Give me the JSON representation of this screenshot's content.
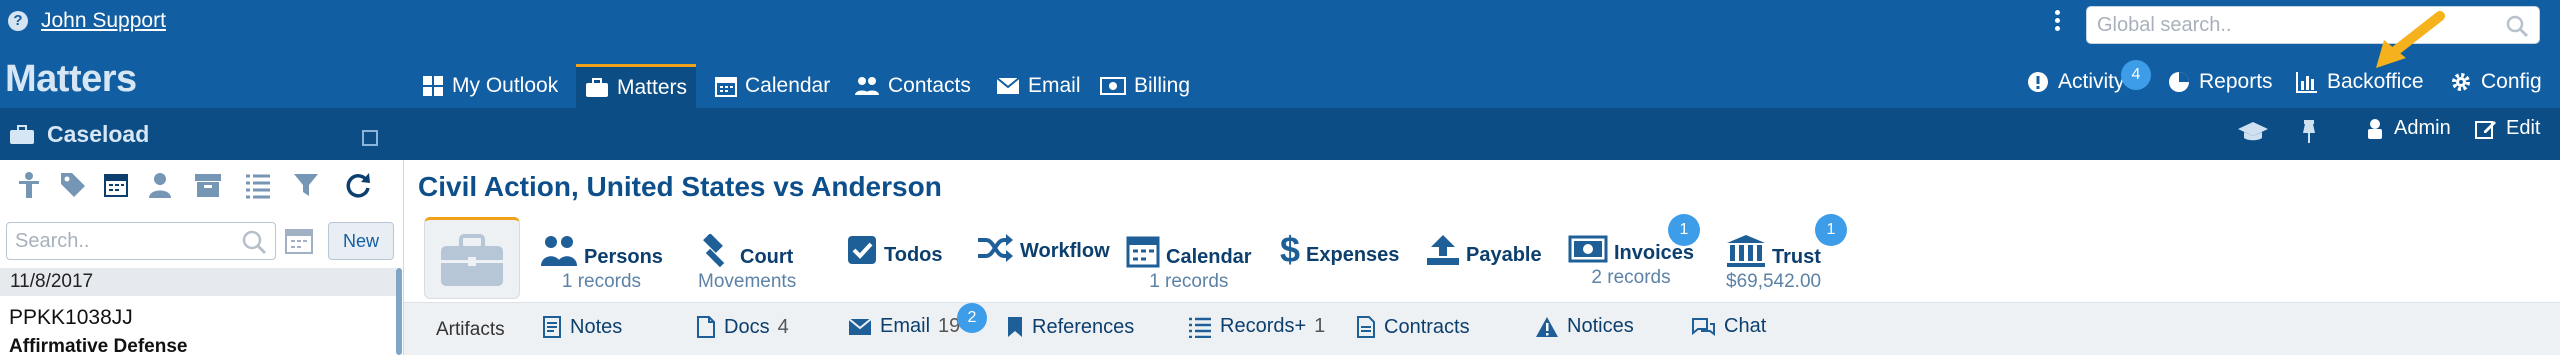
{
  "user": {
    "name": "John Support"
  },
  "search": {
    "placeholder": "Global search.."
  },
  "app": {
    "title": "Matters"
  },
  "nav": [
    {
      "label": "My Outlook",
      "icon": "grid-icon"
    },
    {
      "label": "Matters",
      "icon": "briefcase-icon",
      "active": true
    },
    {
      "label": "Calendar",
      "icon": "calendar-icon"
    },
    {
      "label": "Contacts",
      "icon": "users-icon"
    },
    {
      "label": "Email",
      "icon": "envelope-icon"
    },
    {
      "label": "Billing",
      "icon": "money-icon"
    }
  ],
  "right_nav": [
    {
      "label": "Activity",
      "icon": "alert-icon",
      "badge": "4"
    },
    {
      "label": "Reports",
      "icon": "pie-icon"
    },
    {
      "label": "Backoffice",
      "icon": "bar-chart-icon"
    },
    {
      "label": "Config",
      "icon": "gear-icon"
    }
  ],
  "subbar": {
    "section": "Caseload",
    "admin": "Admin",
    "edit": "Edit"
  },
  "sidebar": {
    "search_placeholder": "Search..",
    "new_label": "New",
    "date": "11/8/2017",
    "case_number": "PPKK1038JJ",
    "case_type": "Affirmative Defense"
  },
  "matter": {
    "title": "Civil Action, United States vs Anderson",
    "tabs": [
      {
        "label": "Persons",
        "sub": "1 records",
        "icon": "persons-icon"
      },
      {
        "label": "Court",
        "sub": "Movements",
        "icon": "gavel-icon"
      },
      {
        "label": "Todos",
        "sub": "",
        "icon": "checkbox-icon"
      },
      {
        "label": "Workflow",
        "sub": "",
        "icon": "shuffle-icon"
      },
      {
        "label": "Calendar",
        "sub": "1 records",
        "icon": "calendar-icon"
      },
      {
        "label": "Expenses",
        "sub": "",
        "icon": "dollar-icon"
      },
      {
        "label": "Payable",
        "sub": "",
        "icon": "upload-icon"
      },
      {
        "label": "Invoices",
        "sub": "2 records",
        "icon": "money-icon",
        "badge": "1"
      },
      {
        "label": "Trust",
        "sub": "$69,542.00",
        "icon": "bank-icon",
        "badge": "1"
      }
    ]
  },
  "artifacts": {
    "label": "Artifacts",
    "items": [
      {
        "label": "Notes",
        "count": "",
        "icon": "notes-icon"
      },
      {
        "label": "Docs",
        "count": "4",
        "icon": "doc-icon"
      },
      {
        "label": "Email",
        "count": "19",
        "badge": "2",
        "icon": "envelope-icon"
      },
      {
        "label": "References",
        "count": "",
        "icon": "bookmark-icon"
      },
      {
        "label": "Records+",
        "count": "1",
        "icon": "list-icon"
      },
      {
        "label": "Contracts",
        "count": "",
        "icon": "doc-icon"
      },
      {
        "label": "Notices",
        "count": "",
        "icon": "warning-icon"
      },
      {
        "label": "Chat",
        "count": "",
        "icon": "chat-icon"
      }
    ]
  },
  "colors": {
    "primary": "#115ea2",
    "dark": "#0c4d86",
    "accent": "#f0a31a",
    "badge": "#3d9de9"
  }
}
